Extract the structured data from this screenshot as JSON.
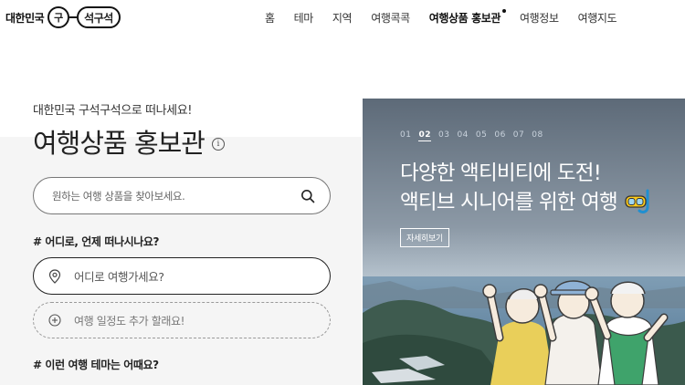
{
  "header": {
    "logo_text": "대한민국",
    "logo_circle": "구",
    "logo_pill": "석구석",
    "nav": [
      {
        "label": "홈",
        "active": false
      },
      {
        "label": "테마",
        "active": false
      },
      {
        "label": "지역",
        "active": false
      },
      {
        "label": "여행콕콕",
        "active": false
      },
      {
        "label": "여행상품 홍보관",
        "active": true
      },
      {
        "label": "여행정보",
        "active": false
      },
      {
        "label": "여행지도",
        "active": false
      }
    ]
  },
  "main": {
    "subtitle": "대한민국 구석구석으로 떠나세요!",
    "title": "여행상품 홍보관",
    "search_placeholder": "원하는 여행 상품을 찾아보세요.",
    "question_1": "# 어디로, 언제 떠나시나요?",
    "where_placeholder": "어디로 여행가세요?",
    "schedule_placeholder": "여행 일정도 추가 할래요!",
    "question_2": "# 이런 여행 테마는 어때요?"
  },
  "banner": {
    "slides": [
      "01",
      "02",
      "03",
      "04",
      "05",
      "06",
      "07",
      "08"
    ],
    "active_slide": "02",
    "headline_line1": "다양한 액티비티에 도전!",
    "headline_line2": "액티브 시니어를 위한 여행",
    "detail_button": "자세히보기"
  },
  "icons": {
    "info": "info-icon",
    "search": "search-icon",
    "location": "location-pin-icon",
    "add": "plus-circle-icon",
    "snorkel": "snorkel-mask-icon"
  }
}
